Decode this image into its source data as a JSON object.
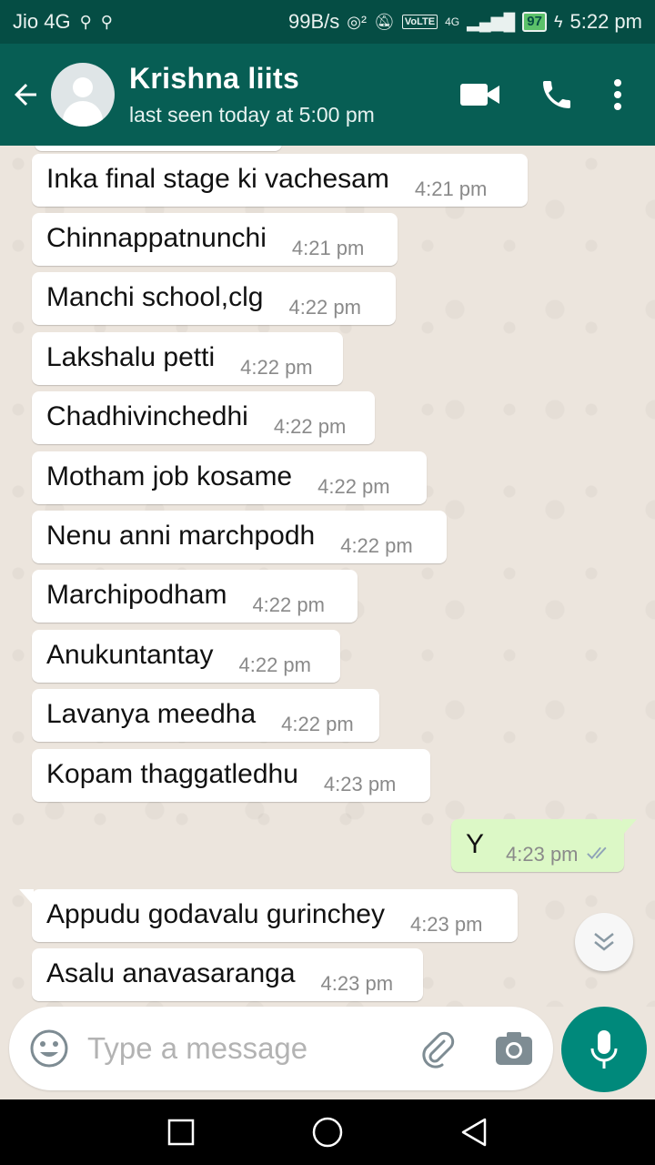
{
  "status_bar": {
    "carrier": "Jio 4G",
    "speed": "99B/s",
    "battery": "97",
    "time": "5:22 pm",
    "volte": "VoLTE",
    "network": "4G"
  },
  "header": {
    "contact_name": "Krishna liits",
    "last_seen": "last seen today at 5:00 pm",
    "icons": [
      "back-arrow-icon",
      "avatar",
      "video-call-icon",
      "phone-icon",
      "more-vert-icon"
    ]
  },
  "messages": [
    {
      "text": "Inka final stage ki vachesam",
      "time": "4:21 pm",
      "direction": "in"
    },
    {
      "text": "Chinnappatnunchi",
      "time": "4:21 pm",
      "direction": "in"
    },
    {
      "text": "Manchi school,clg",
      "time": "4:22 pm",
      "direction": "in"
    },
    {
      "text": "Lakshalu petti",
      "time": "4:22 pm",
      "direction": "in"
    },
    {
      "text": "Chadhivinchedhi",
      "time": "4:22 pm",
      "direction": "in"
    },
    {
      "text": "Motham job kosame",
      "time": "4:22 pm",
      "direction": "in"
    },
    {
      "text": "Nenu anni marchpodh",
      "time": "4:22 pm",
      "direction": "in"
    },
    {
      "text": "Marchipodham",
      "time": "4:22 pm",
      "direction": "in"
    },
    {
      "text": "Anukuntantay",
      "time": "4:22 pm",
      "direction": "in"
    },
    {
      "text": "Lavanya meedha",
      "time": "4:22 pm",
      "direction": "in"
    },
    {
      "text": "Kopam thaggatledhu",
      "time": "4:23 pm",
      "direction": "in"
    },
    {
      "text": "Y",
      "time": "4:23 pm",
      "direction": "out",
      "status": "read"
    },
    {
      "text": "Appudu godavalu gurinchey",
      "time": "4:23 pm",
      "direction": "in"
    },
    {
      "text": "Asalu anavasaranga",
      "time": "4:23 pm",
      "direction": "in"
    }
  ],
  "input": {
    "placeholder": "Type a message"
  },
  "colors": {
    "header": "#075e54",
    "status_bar": "#054d44",
    "outgoing_bubble": "#dcf8c6",
    "incoming_bubble": "#ffffff",
    "mic_button": "#00897b",
    "read_ticks": "#34b7f1"
  }
}
